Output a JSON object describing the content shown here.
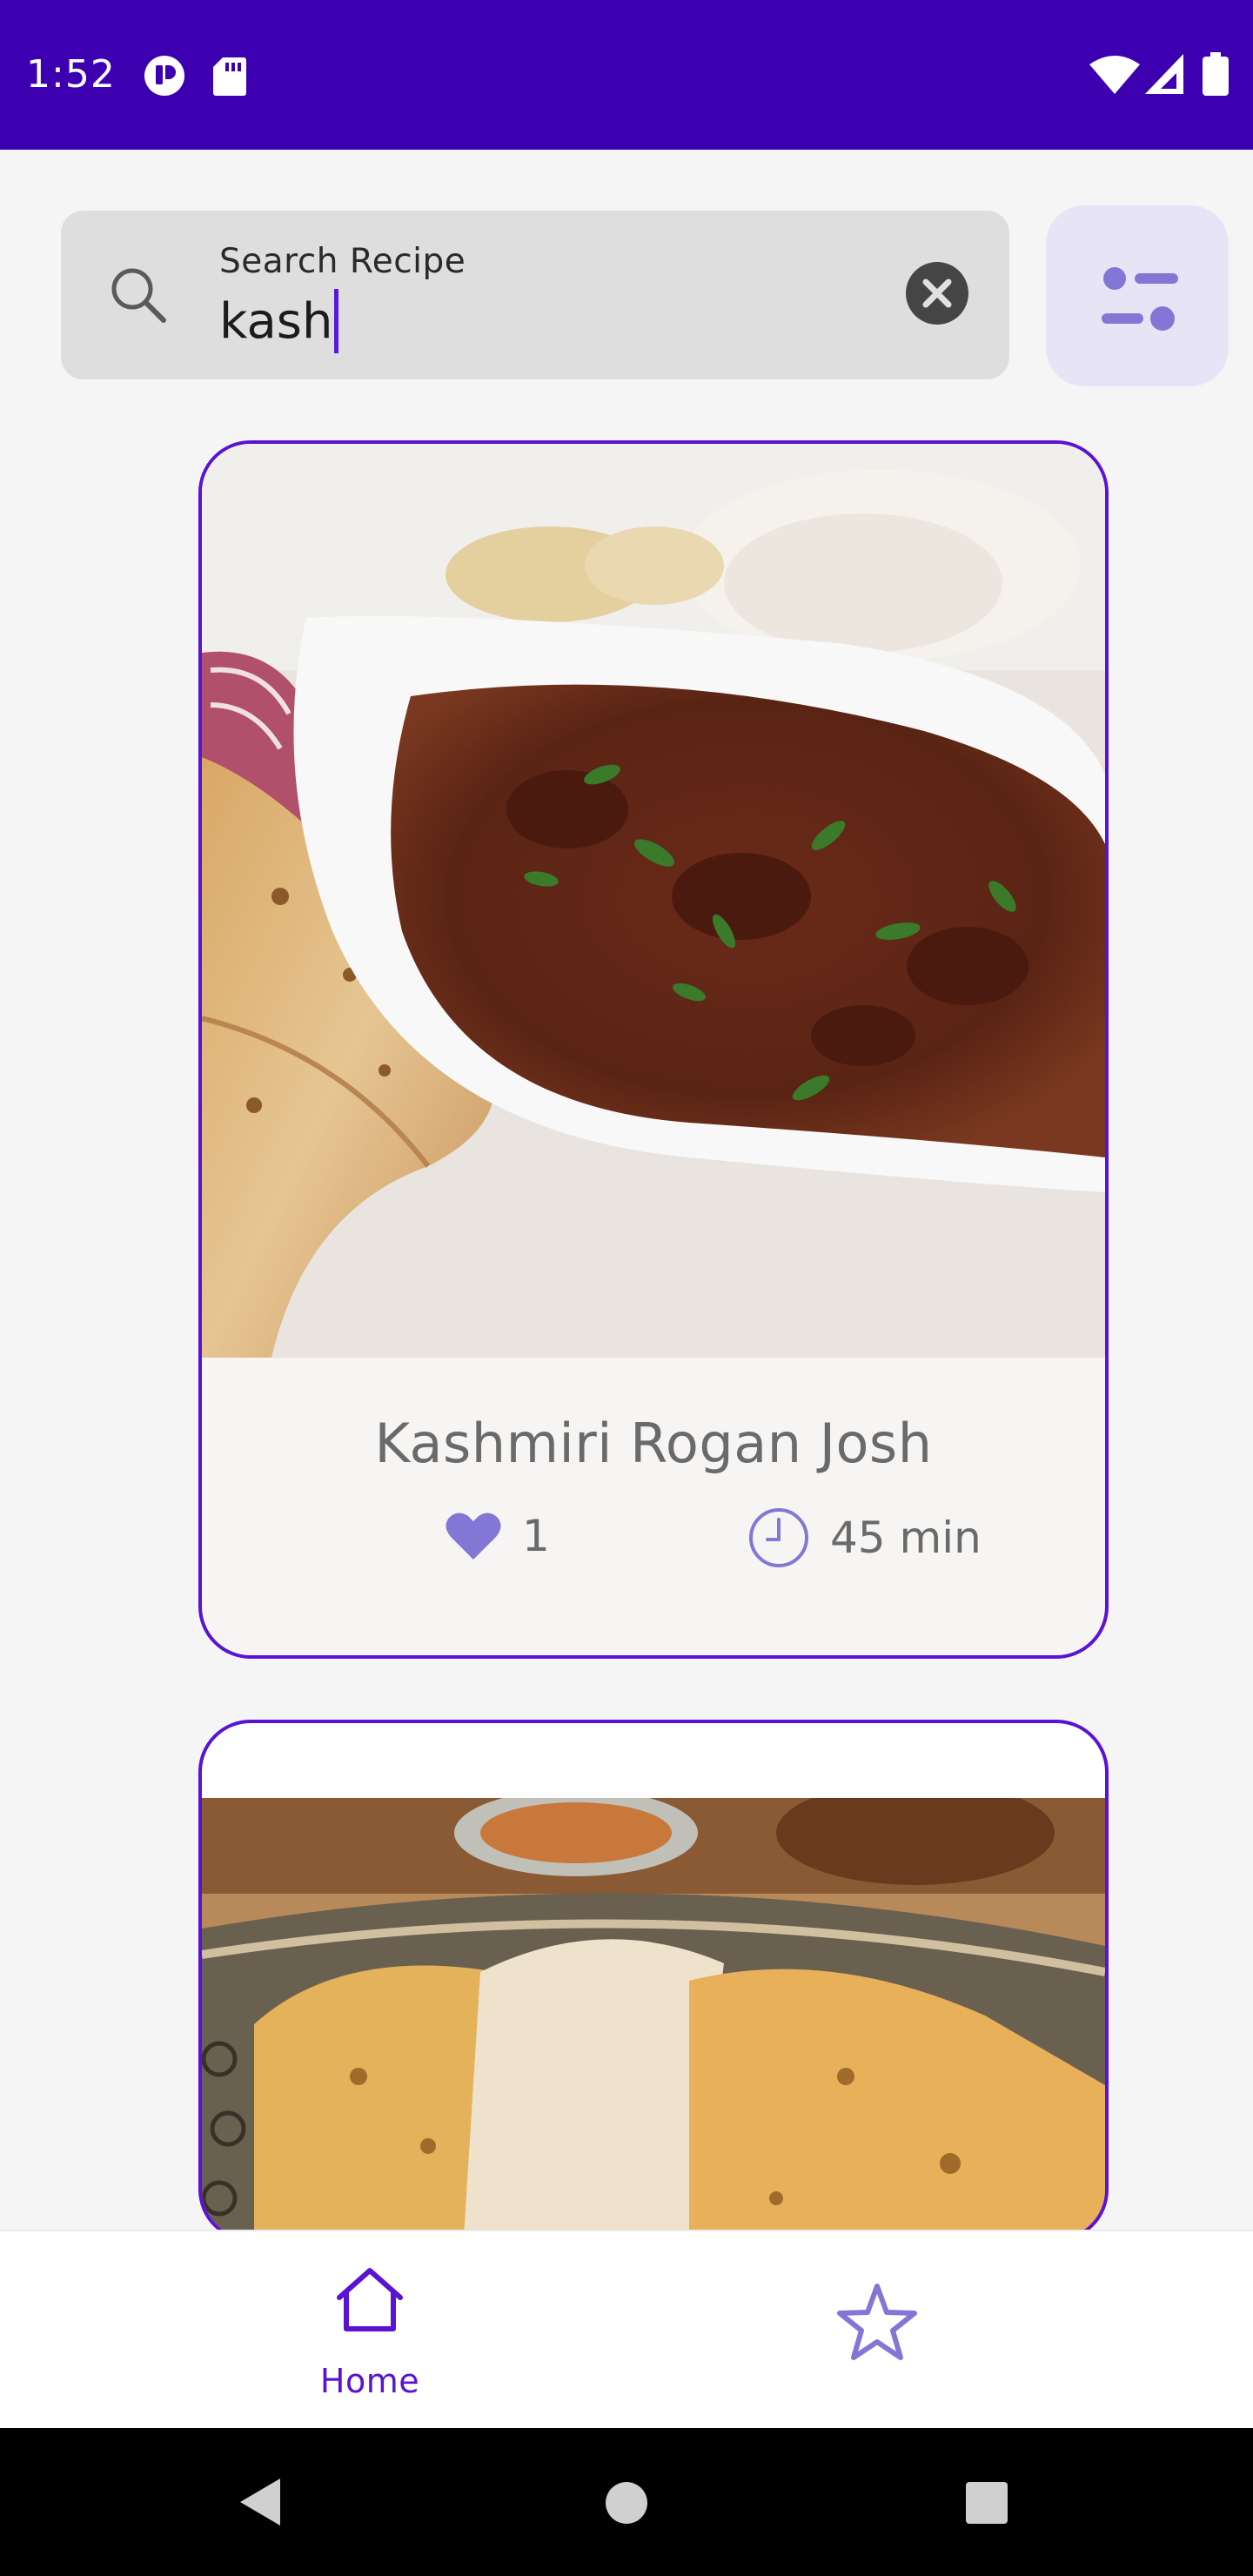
{
  "status_bar": {
    "time": "1:52",
    "icons": [
      "app-notification-icon",
      "sd-card-icon",
      "wifi-icon",
      "cell-signal-icon",
      "battery-icon"
    ]
  },
  "search": {
    "label": "Search Recipe",
    "value": "kash",
    "icons": [
      "search-icon",
      "clear-icon"
    ]
  },
  "filter_button": {
    "icon": "filter-sliders-icon"
  },
  "recipes": [
    {
      "title": "Kashmiri Rogan Josh",
      "likes": "1",
      "time": "45 min"
    }
  ],
  "bottom_nav": {
    "items": [
      {
        "label": "Home",
        "icon": "home-icon",
        "selected": true
      },
      {
        "label": "",
        "icon": "star-icon",
        "selected": false
      }
    ]
  },
  "system_nav": {
    "icons": [
      "back-icon",
      "home-circle-icon",
      "recents-icon"
    ]
  },
  "colors": {
    "primary": "#3d00b0",
    "accent": "#5a12d4",
    "icon_purple": "#8476d4",
    "card_background": "#f7f5f3"
  }
}
